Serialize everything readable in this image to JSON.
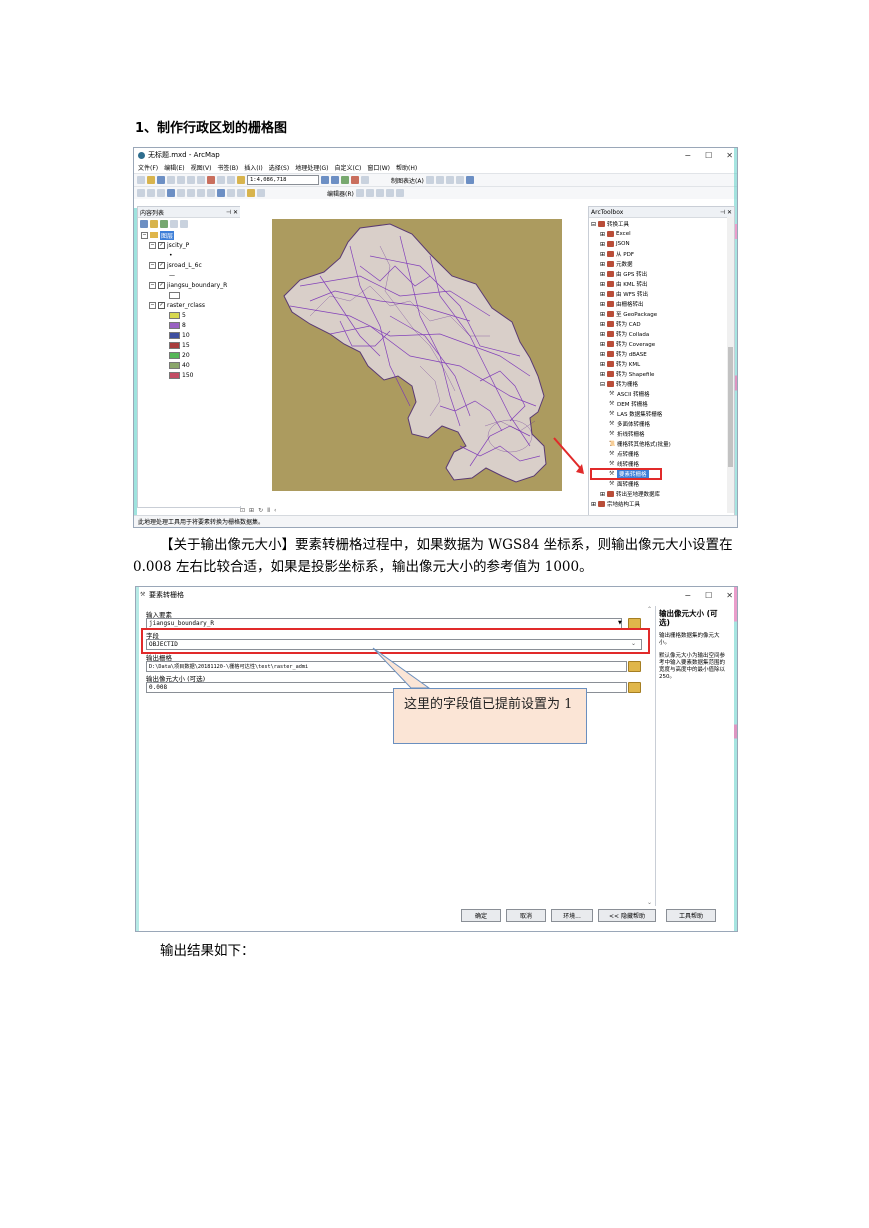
{
  "heading": "1、制作行政区划的栅格图",
  "arcmap": {
    "title": "无标题.mxd - ArcMap",
    "menu": [
      "文件(F)",
      "编辑(E)",
      "视图(V)",
      "书签(B)",
      "插入(I)",
      "选择(S)",
      "地理处理(G)",
      "自定义(C)",
      "窗口(W)",
      "帮助(H)"
    ],
    "scale": "1:4,086,718",
    "toolbar_labels": {
      "layout": "制图表达(A)",
      "editor": "编辑器(R)"
    },
    "toc": {
      "title": "内容列表",
      "root": "图层",
      "layers": [
        "jscity_P",
        "jsroad_L_6c",
        "jiangsu_boundary_R",
        "raster_rclass"
      ],
      "legend": [
        {
          "label": "5",
          "color": "#d7d84f"
        },
        {
          "label": "8",
          "color": "#9a61c2"
        },
        {
          "label": "10",
          "color": "#3f4fa0"
        },
        {
          "label": "15",
          "color": "#a83d3d"
        },
        {
          "label": "20",
          "color": "#56b657"
        },
        {
          "label": "40",
          "color": "#8aa66a"
        },
        {
          "label": "150",
          "color": "#c24c63"
        }
      ]
    },
    "toolbox": {
      "title": "ArcToolbox",
      "items": [
        {
          "label": "转换工具",
          "level": 0,
          "kind": "box",
          "exp": "⊟"
        },
        {
          "label": "Excel",
          "level": 1,
          "kind": "box",
          "exp": "⊞"
        },
        {
          "label": "JSON",
          "level": 1,
          "kind": "box",
          "exp": "⊞"
        },
        {
          "label": "从 PDF",
          "level": 1,
          "kind": "box",
          "exp": "⊞"
        },
        {
          "label": "元数据",
          "level": 1,
          "kind": "box",
          "exp": "⊞"
        },
        {
          "label": "由 GPS 转出",
          "level": 1,
          "kind": "box",
          "exp": "⊞"
        },
        {
          "label": "由 KML 转出",
          "level": 1,
          "kind": "box",
          "exp": "⊞"
        },
        {
          "label": "由 WFS 转出",
          "level": 1,
          "kind": "box",
          "exp": "⊞"
        },
        {
          "label": "由栅格转出",
          "level": 1,
          "kind": "box",
          "exp": "⊞"
        },
        {
          "label": "至 GeoPackage",
          "level": 1,
          "kind": "box",
          "exp": "⊞"
        },
        {
          "label": "转为 CAD",
          "level": 1,
          "kind": "box",
          "exp": "⊞"
        },
        {
          "label": "转为 Collada",
          "level": 1,
          "kind": "box",
          "exp": "⊞"
        },
        {
          "label": "转为 Coverage",
          "level": 1,
          "kind": "box",
          "exp": "⊞"
        },
        {
          "label": "转为 dBASE",
          "level": 1,
          "kind": "box",
          "exp": "⊞"
        },
        {
          "label": "转为 KML",
          "level": 1,
          "kind": "box",
          "exp": "⊞"
        },
        {
          "label": "转为 Shapefile",
          "level": 1,
          "kind": "box",
          "exp": "⊞"
        },
        {
          "label": "转为栅格",
          "level": 1,
          "kind": "box",
          "exp": "⊟"
        },
        {
          "label": "ASCII 转栅格",
          "level": 2,
          "kind": "tool",
          "exp": ""
        },
        {
          "label": "DEM 转栅格",
          "level": 2,
          "kind": "tool",
          "exp": ""
        },
        {
          "label": "LAS 数据集转栅格",
          "level": 2,
          "kind": "tool",
          "exp": ""
        },
        {
          "label": "多面体转栅格",
          "level": 2,
          "kind": "tool",
          "exp": ""
        },
        {
          "label": "折线转栅格",
          "level": 2,
          "kind": "tool",
          "exp": ""
        },
        {
          "label": "栅格转其他格式(批量)",
          "level": 2,
          "kind": "script",
          "exp": ""
        },
        {
          "label": "点转栅格",
          "level": 2,
          "kind": "tool",
          "exp": ""
        },
        {
          "label": "线转栅格",
          "level": 2,
          "kind": "tool",
          "exp": ""
        },
        {
          "label": "要素转栅格",
          "level": 2,
          "kind": "tool",
          "exp": "",
          "selected": true
        },
        {
          "label": "面转栅格",
          "level": 2,
          "kind": "tool",
          "exp": ""
        },
        {
          "label": "转出至地理数据库",
          "level": 1,
          "kind": "box",
          "exp": "⊞"
        },
        {
          "label": "宗地结构工具",
          "level": 0,
          "kind": "box",
          "exp": "⊞"
        }
      ]
    },
    "status": "此地理处理工具用于将要素转换为栅格数据集。"
  },
  "para1": "【关于输出像元大小】要素转栅格过程中，如果数据为 WGS84 坐标系，则输出像元大小设置在 0.008 左右比较合适，如果是投影坐标系，输出像元大小的参考值为 1000。",
  "dialog": {
    "title": "要素转栅格",
    "input_label": "输入要素",
    "input_value": "jiangsu_boundary_R",
    "field_label": "字段",
    "field_value": "OBJECTID",
    "output_label": "输出栅格",
    "output_value": "D:\\Data\\项目数据\\20181120-\\栅格可达性\\test\\raster_admi",
    "cell_label": "输出像元大小 (可选)",
    "cell_value": "0.008",
    "callout": "这里的字段值已提前设置为 1",
    "help_title": "输出像元大小 (可选)",
    "help_p1": "输出栅格数据集的像元大小。",
    "help_p2": "默认像元大小为输出空间参考中输入要素数据集范围的宽度与高度中的最小值除以 250。",
    "buttons": [
      "确定",
      "取消",
      "环境...",
      "<< 隐藏帮助",
      "工具帮助"
    ]
  },
  "para2": "输出结果如下："
}
